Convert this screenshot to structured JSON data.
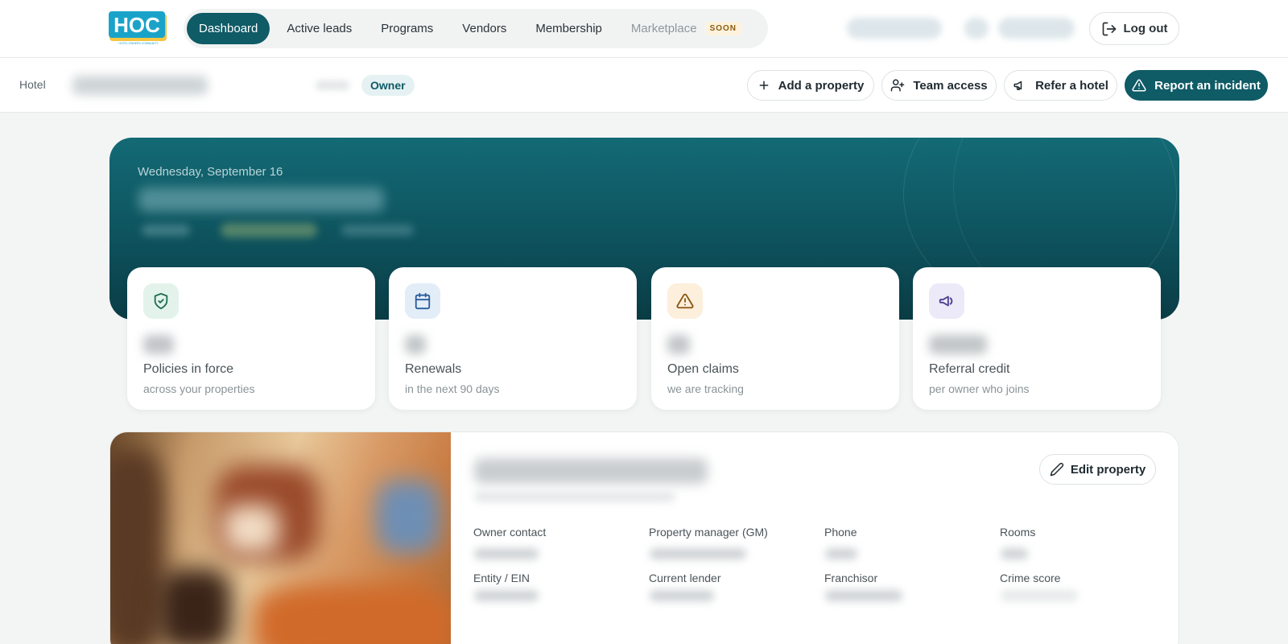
{
  "brand": {
    "logo_text": "HOC",
    "logo_tagline": "HOTEL OWNERS COMMUNITY"
  },
  "nav": {
    "items": [
      {
        "label": "Dashboard",
        "active": true
      },
      {
        "label": "Active leads"
      },
      {
        "label": "Programs"
      },
      {
        "label": "Vendors"
      },
      {
        "label": "Membership"
      },
      {
        "label": "Marketplace",
        "disabled": true,
        "badge": "SOON"
      }
    ],
    "logout_label": "Log out"
  },
  "subbar": {
    "hotel_label": "Hotel",
    "role_badge": "Owner",
    "actions": [
      {
        "label": "Add a property",
        "icon": "plus-icon"
      },
      {
        "label": "Team access",
        "icon": "user-plus-icon"
      },
      {
        "label": "Refer a hotel",
        "icon": "megaphone-icon"
      },
      {
        "label": "Report an incident",
        "icon": "alert-triangle-icon",
        "primary": true
      }
    ]
  },
  "hero": {
    "date": "Wednesday, September 16"
  },
  "stats": [
    {
      "label": "Policies in force",
      "sub": "across your properties",
      "icon": "shield-check-icon",
      "icon_bg": "#e3f3ec",
      "icon_color": "#1f6e52"
    },
    {
      "label": "Renewals",
      "sub": "in the next 90 days",
      "icon": "calendar-icon",
      "icon_bg": "#e3edf8",
      "icon_color": "#2b5d9a"
    },
    {
      "label": "Open claims",
      "sub": "we are tracking",
      "icon": "alert-triangle-icon",
      "icon_bg": "#fcefdc",
      "icon_color": "#8a5512"
    },
    {
      "label": "Referral credit",
      "sub": "per owner who joins",
      "icon": "megaphone-icon",
      "icon_bg": "#ece9f8",
      "icon_color": "#4a3f8f"
    }
  ],
  "property": {
    "edit_label": "Edit property",
    "fields": [
      {
        "label": "Owner contact"
      },
      {
        "label": "Property manager (GM)"
      },
      {
        "label": "Phone"
      },
      {
        "label": "Rooms"
      },
      {
        "label": "Entity / EIN"
      },
      {
        "label": "Current lender"
      },
      {
        "label": "Franchisor"
      },
      {
        "label": "Crime score"
      }
    ]
  },
  "colors": {
    "primary": "#0f5b66",
    "page_bg": "#f3f5f4",
    "hero_top": "#136a75",
    "hero_bottom": "#0a3c45"
  }
}
